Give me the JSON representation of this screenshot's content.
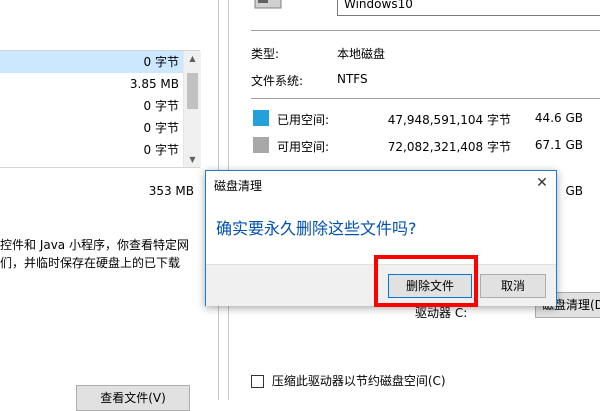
{
  "left_window": {
    "list_rows": [
      {
        "size": "0 字节"
      },
      {
        "size": "3.85 MB"
      },
      {
        "size": "0 字节"
      },
      {
        "size": "0 字节"
      },
      {
        "size": "0 字节"
      }
    ],
    "total_size": "353 MB",
    "description_line1": "控件和 Java 小程序，你查看特定网",
    "description_line2": "们，并临时保存在硬盘上的已下载",
    "view_files_button": "查看文件(V)"
  },
  "properties": {
    "drive_name": "Windows10",
    "type_label": "类型:",
    "type_value": "本地磁盘",
    "fs_label": "文件系统:",
    "fs_value": "NTFS",
    "used_label": "已用空间:",
    "used_bytes": "47,948,591,104 字节",
    "used_gb": "44.6 GB",
    "free_label": "可用空间:",
    "free_bytes": "72,082,321,408 字节",
    "free_gb": "67.1 GB",
    "capacity_gb_partial": "GB",
    "drive_label": "驱动器 C:",
    "cleanup_button": "磁盘清理(D)",
    "compress_label": "压缩此驱动器以节约磁盘空间(C)",
    "colors": {
      "used": "#26a0da",
      "free": "#a8a8a8"
    }
  },
  "dialog": {
    "title": "磁盘清理",
    "message": "确实要永久删除这些文件吗?",
    "delete_button": "删除文件",
    "cancel_button": "取消",
    "close_icon": "close-icon",
    "highlight_color": "#ff0000"
  }
}
